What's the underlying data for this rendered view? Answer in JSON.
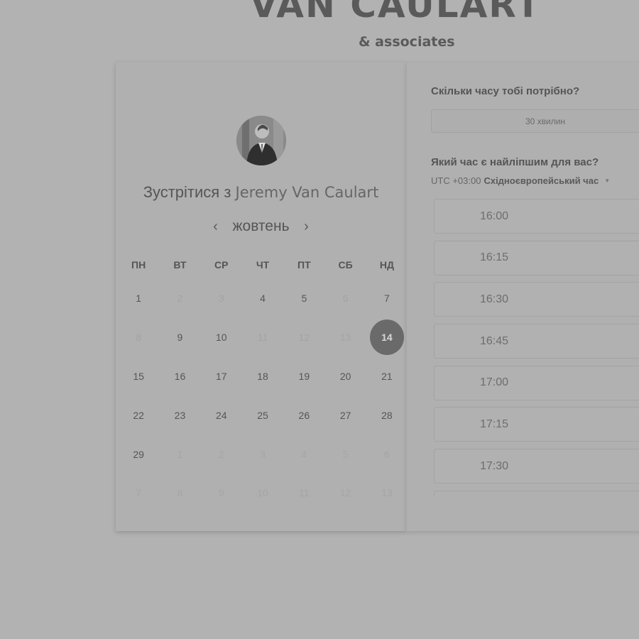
{
  "brand": {
    "name": "VAN CAULART",
    "sub": "& associates"
  },
  "host": {
    "prefix": "Зустрітися з",
    "name": "Jeremy Van Caulart"
  },
  "calendar": {
    "month": "жовтень",
    "prev_icon": "‹",
    "next_icon": "›",
    "weekdays": [
      "ПН",
      "ВТ",
      "СР",
      "ЧТ",
      "ПТ",
      "СБ",
      "НД"
    ],
    "weeks": [
      [
        {
          "d": "1",
          "s": "active"
        },
        {
          "d": "2",
          "s": "disabled"
        },
        {
          "d": "3",
          "s": "disabled"
        },
        {
          "d": "4",
          "s": "active"
        },
        {
          "d": "5",
          "s": "active"
        },
        {
          "d": "6",
          "s": "disabled"
        },
        {
          "d": "7",
          "s": "active"
        }
      ],
      [
        {
          "d": "8",
          "s": "disabled"
        },
        {
          "d": "9",
          "s": "active"
        },
        {
          "d": "10",
          "s": "active"
        },
        {
          "d": "11",
          "s": "disabled"
        },
        {
          "d": "12",
          "s": "disabled"
        },
        {
          "d": "13",
          "s": "disabled"
        },
        {
          "d": "14",
          "s": "selected"
        }
      ],
      [
        {
          "d": "15",
          "s": "active"
        },
        {
          "d": "16",
          "s": "active"
        },
        {
          "d": "17",
          "s": "active"
        },
        {
          "d": "18",
          "s": "active"
        },
        {
          "d": "19",
          "s": "active"
        },
        {
          "d": "20",
          "s": "active"
        },
        {
          "d": "21",
          "s": "active"
        }
      ],
      [
        {
          "d": "22",
          "s": "active"
        },
        {
          "d": "23",
          "s": "active"
        },
        {
          "d": "24",
          "s": "active"
        },
        {
          "d": "25",
          "s": "active"
        },
        {
          "d": "26",
          "s": "active"
        },
        {
          "d": "27",
          "s": "active"
        },
        {
          "d": "28",
          "s": "active"
        }
      ],
      [
        {
          "d": "29",
          "s": "active"
        },
        {
          "d": "1",
          "s": "outside"
        },
        {
          "d": "2",
          "s": "outside"
        },
        {
          "d": "3",
          "s": "outside"
        },
        {
          "d": "4",
          "s": "outside"
        },
        {
          "d": "5",
          "s": "outside"
        },
        {
          "d": "6",
          "s": "outside"
        }
      ],
      [
        {
          "d": "7",
          "s": "outside"
        },
        {
          "d": "8",
          "s": "outside"
        },
        {
          "d": "9",
          "s": "outside"
        },
        {
          "d": "10",
          "s": "outside"
        },
        {
          "d": "11",
          "s": "outside"
        },
        {
          "d": "12",
          "s": "outside"
        },
        {
          "d": "13",
          "s": "outside"
        }
      ]
    ]
  },
  "booking": {
    "duration_question": "Скільки часу тобі потрібно?",
    "duration_value": "30 хвилин",
    "time_question": "Який час є найліпшим для вас?",
    "tz_offset": "UTC +03:00",
    "tz_name": "Східноєвропейський час",
    "tz_caret": "▼",
    "slots": [
      "16:00",
      "16:15",
      "16:30",
      "16:45",
      "17:00",
      "17:15",
      "17:30"
    ]
  },
  "colors": {
    "background": "#b2b2b2",
    "selected_day": "#6a6a6a"
  }
}
